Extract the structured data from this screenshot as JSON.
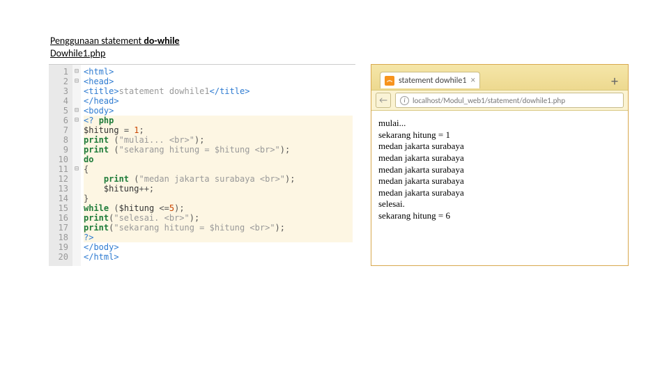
{
  "heading": {
    "line1_a": "Penggunaan statement ",
    "line1_b": "do-while",
    "line2": "Dowhile1.php"
  },
  "editor": {
    "lines": [
      {
        "n": "1",
        "fold": "⊟",
        "html": "<span class='tag'>&lt;html&gt;</span>"
      },
      {
        "n": "2",
        "fold": "⊟",
        "html": "<span class='tag'>&lt;head&gt;</span>"
      },
      {
        "n": "3",
        "fold": "",
        "html": "<span class='tag'>&lt;title&gt;</span><span class='txt'>statement dowhile1</span><span class='tag'>&lt;/title&gt;</span>"
      },
      {
        "n": "4",
        "fold": "",
        "html": "<span class='tag'>&lt;/head&gt;</span>"
      },
      {
        "n": "5",
        "fold": "⊟",
        "html": "<span class='tag'>&lt;body&gt;</span>"
      },
      {
        "n": "6",
        "fold": "⊟",
        "php": true,
        "html": "<span class='tag'>&lt;?</span> <span class='kw'>php</span>"
      },
      {
        "n": "7",
        "fold": "",
        "php": true,
        "html": "<span class='var'>$hitung</span> <span class='pun'>=</span> <span class='num'>1</span><span class='pun'>;</span>"
      },
      {
        "n": "8",
        "fold": "",
        "php": true,
        "html": "<span class='kw'>print</span> <span class='pun'>(</span><span class='str'>\"mulai... &lt;br&gt;\"</span><span class='pun'>);</span>"
      },
      {
        "n": "9",
        "fold": "",
        "php": true,
        "html": "<span class='kw'>print</span> <span class='pun'>(</span><span class='str'>\"sekarang hitung = $hitung &lt;br&gt;\"</span><span class='pun'>);</span>"
      },
      {
        "n": "10",
        "fold": "",
        "php": true,
        "html": "<span class='kw'>do</span>"
      },
      {
        "n": "11",
        "fold": "⊟",
        "php": true,
        "html": "<span class='pun'>{</span>"
      },
      {
        "n": "12",
        "fold": "",
        "php": true,
        "html": "    <span class='kw'>print</span> <span class='pun'>(</span><span class='str'>\"medan jakarta surabaya &lt;br&gt;\"</span><span class='pun'>);</span>"
      },
      {
        "n": "13",
        "fold": "",
        "php": true,
        "html": "    <span class='var'>$hitung</span><span class='pun'>++;</span>"
      },
      {
        "n": "14",
        "fold": "",
        "php": true,
        "html": "<span class='pun'>}</span>"
      },
      {
        "n": "15",
        "fold": "",
        "php": true,
        "html": "<span class='kw'>while</span> <span class='pun'>(</span><span class='var'>$hitung</span> <span class='pun'>&lt;=</span><span class='num'>5</span><span class='pun'>);</span>"
      },
      {
        "n": "16",
        "fold": "",
        "php": true,
        "html": "<span class='kw'>print</span><span class='pun'>(</span><span class='str'>\"selesai. &lt;br&gt;\"</span><span class='pun'>);</span>"
      },
      {
        "n": "17",
        "fold": "",
        "php": true,
        "html": "<span class='kw'>print</span><span class='pun'>(</span><span class='str'>\"sekarang hitung = $hitung &lt;br&gt;\"</span><span class='pun'>);</span>"
      },
      {
        "n": "18",
        "fold": "",
        "php": true,
        "html": "<span class='tag'>?&gt;</span>"
      },
      {
        "n": "19",
        "fold": "",
        "html": "<span class='tag'>&lt;/body&gt;</span>"
      },
      {
        "n": "20",
        "fold": "",
        "html": "<span class='tag'>&lt;/html&gt;</span>"
      }
    ]
  },
  "browser": {
    "tab_title": "statement dowhile1",
    "tab_close": "×",
    "tab_plus": "+",
    "back_glyph": "←",
    "info_glyph": "i",
    "url": "localhost/Modul_web1/statement/dowhile1.php",
    "output": [
      "mulai...",
      "sekarang hitung = 1",
      "medan jakarta surabaya",
      "medan jakarta surabaya",
      "medan jakarta surabaya",
      "medan jakarta surabaya",
      "medan jakarta surabaya",
      "selesai.",
      "sekarang hitung = 6"
    ]
  }
}
